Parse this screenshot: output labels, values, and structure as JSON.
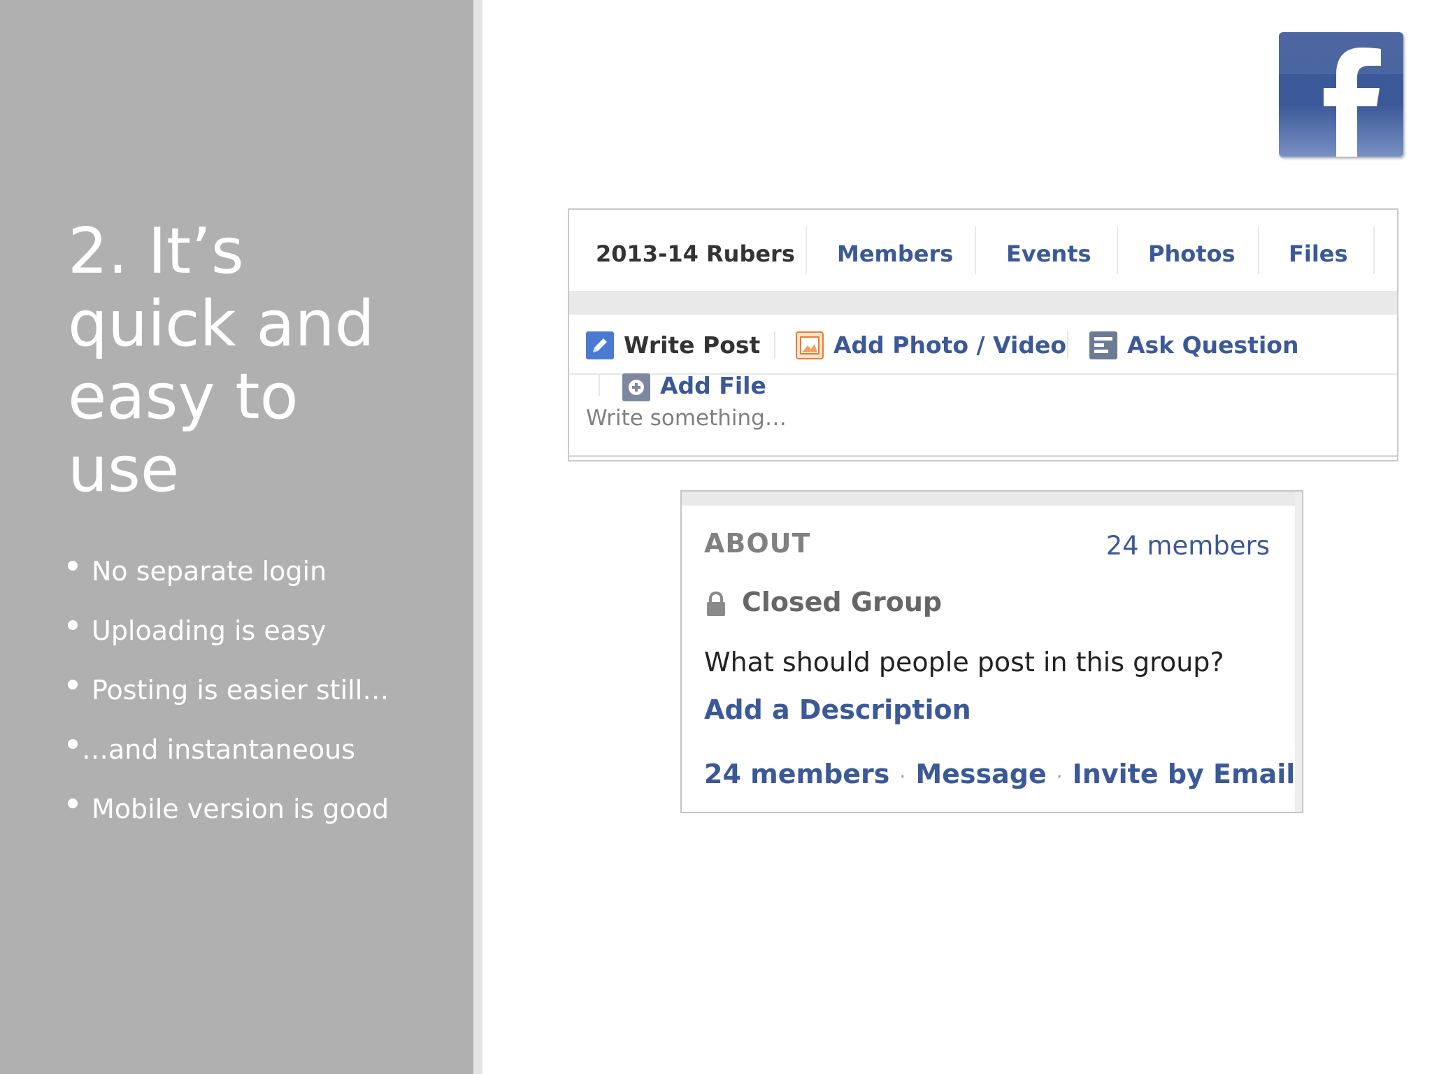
{
  "slide": {
    "title_lines": [
      "2. It’s",
      "quick and",
      "easy to",
      "use"
    ],
    "bullets": [
      "No separate login",
      "Uploading is easy",
      "Posting is easier still…",
      "…and instantaneous",
      "Mobile version is good"
    ]
  },
  "logo": {
    "icon": "facebook-f-icon",
    "letter": "f"
  },
  "group": {
    "name": "2013-14 Rubers",
    "tabs": [
      "Members",
      "Events",
      "Photos",
      "Files"
    ]
  },
  "composer": {
    "actions": [
      {
        "label": "Write Post",
        "icon": "pencil-icon"
      },
      {
        "label": "Add Photo / Video",
        "icon": "photo-icon"
      },
      {
        "label": "Ask Question",
        "icon": "question-list-icon"
      },
      {
        "label": "Add File",
        "icon": "add-file-icon"
      }
    ],
    "placeholder": "Write something…"
  },
  "about": {
    "title": "ABOUT",
    "member_count": "24 members",
    "privacy": "Closed Group",
    "privacy_icon": "lock-icon",
    "question": "What should people post in this group?",
    "add_description": "Add a Description",
    "links": [
      "24 members",
      "Message",
      "Invite by Email"
    ],
    "separator": "·"
  },
  "colors": {
    "panel_gray": "#b0b0b0",
    "facebook_blue": "#3b5998",
    "text_dark": "#333333",
    "muted_gray": "#808080"
  }
}
